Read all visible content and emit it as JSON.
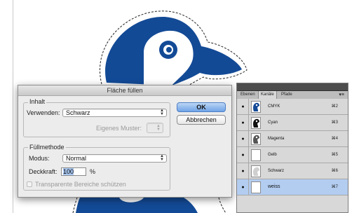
{
  "dialog": {
    "title": "Fläche füllen",
    "inhalt_label": "Inhalt",
    "verwenden_label": "Verwenden:",
    "verwenden_value": "Schwarz",
    "eigenes_muster_label": "Eigenes Muster:",
    "fuellmethode_label": "Füllmethode",
    "modus_label": "Modus:",
    "modus_value": "Normal",
    "deckkraft_label": "Deckkraft:",
    "deckkraft_value": "100",
    "deckkraft_unit": "%",
    "transparent_label": "Transparente Bereiche schützen",
    "transparent_checked": false,
    "ok_label": "OK",
    "cancel_label": "Abbrechen"
  },
  "panel": {
    "tabs": [
      "Ebenen",
      "Kanäle",
      "Pfade"
    ],
    "active_tab": "Kanäle",
    "channels": [
      {
        "name": "CMYK",
        "shortcut": "⌘2",
        "selected": false
      },
      {
        "name": "Cyan",
        "shortcut": "⌘3",
        "selected": false
      },
      {
        "name": "Magenta",
        "shortcut": "⌘4",
        "selected": false
      },
      {
        "name": "Gelb",
        "shortcut": "⌘5",
        "selected": false
      },
      {
        "name": "Schwarz",
        "shortcut": "⌘6",
        "selected": false
      },
      {
        "name": "weiss",
        "shortcut": "⌘7",
        "selected": true
      }
    ]
  },
  "colors": {
    "penguin_blue": "#134a96",
    "selection_blue": "#b3cdf0",
    "ok_button": "#6fa3e6"
  }
}
